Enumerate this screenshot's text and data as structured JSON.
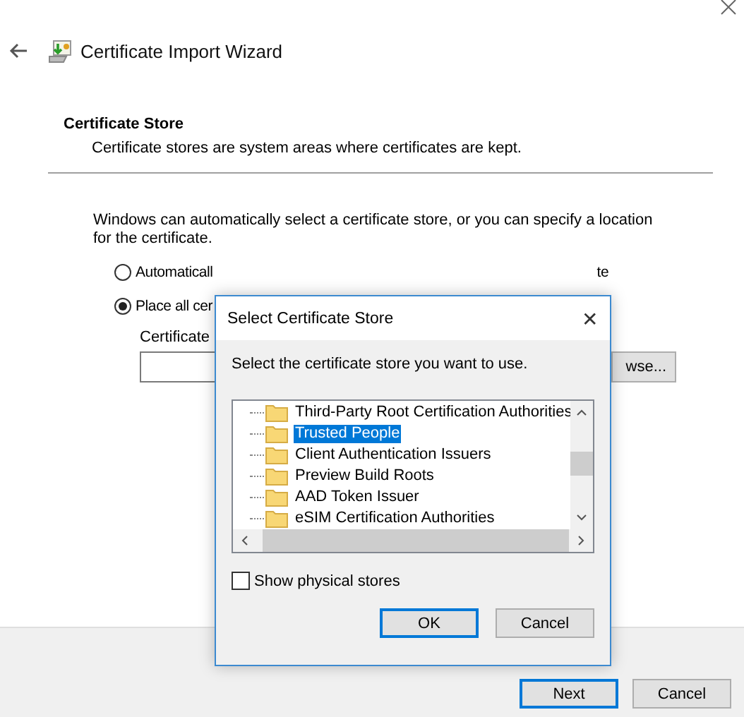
{
  "wizard": {
    "title": "Certificate Import Wizard",
    "section_title": "Certificate Store",
    "section_description": "Certificate stores are system areas where certificates are kept.",
    "intro": "Windows can automatically select a certificate store, or you can specify a location for the certificate.",
    "options": [
      {
        "label": "Automaticall",
        "label_tail": "te",
        "selected": false
      },
      {
        "label": "Place all cer",
        "selected": true
      }
    ],
    "store_label": "Certificate ",
    "browse_button": "wse...",
    "buttons": [
      {
        "label": "Next",
        "default": true
      },
      {
        "label": "Cancel",
        "default": false
      }
    ]
  },
  "dialog": {
    "title": "Select Certificate Store",
    "close": "✕",
    "prompt": "Select the certificate store you want to use.",
    "stores": [
      {
        "name": "Third-Party Root Certification Authorities",
        "selected": false
      },
      {
        "name": "Trusted People",
        "selected": true
      },
      {
        "name": "Client Authentication Issuers",
        "selected": false
      },
      {
        "name": "Preview Build Roots",
        "selected": false
      },
      {
        "name": "AAD Token Issuer",
        "selected": false
      },
      {
        "name": "eSIM Certification Authorities",
        "selected": false
      }
    ],
    "show_physical": {
      "label": "Show physical stores",
      "checked": false
    },
    "buttons": [
      {
        "label": "OK",
        "default": true
      },
      {
        "label": "Cancel",
        "default": false
      }
    ]
  }
}
